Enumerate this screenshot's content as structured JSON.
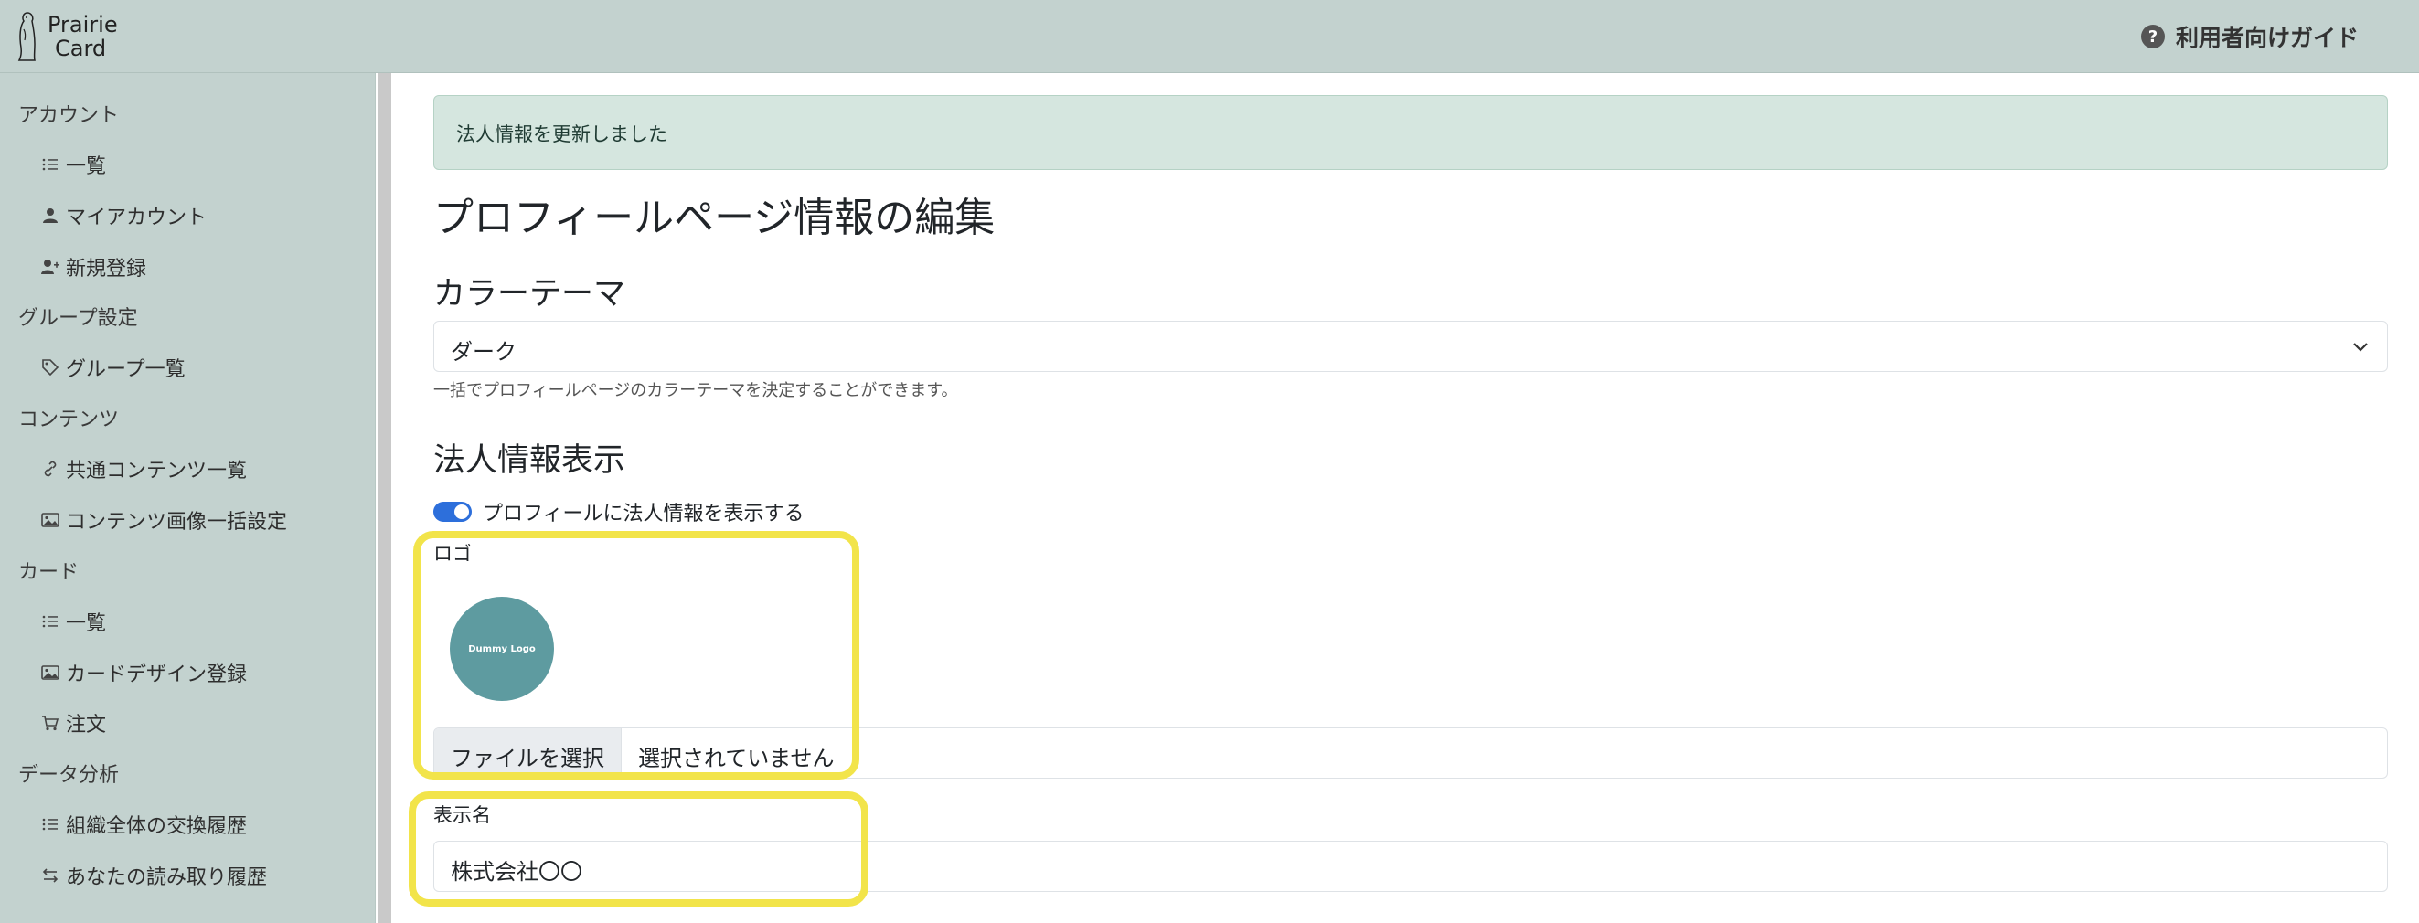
{
  "header": {
    "brand_line1": "Prairie",
    "brand_line2": "Card",
    "guide_label": "利用者向けガイド",
    "guide_icon": "?"
  },
  "sidebar": {
    "sections": [
      {
        "label": "アカウント",
        "items": [
          {
            "label": "一覧",
            "icon": "list-icon"
          },
          {
            "label": "マイアカウント",
            "icon": "person-icon"
          },
          {
            "label": "新規登録",
            "icon": "person-add-icon"
          }
        ]
      },
      {
        "label": "グループ設定",
        "items": [
          {
            "label": "グループ一覧",
            "icon": "tag-icon"
          }
        ]
      },
      {
        "label": "コンテンツ",
        "items": [
          {
            "label": "共通コンテンツ一覧",
            "icon": "link-icon"
          },
          {
            "label": "コンテンツ画像一括設定",
            "icon": "image-icon"
          }
        ]
      },
      {
        "label": "カード",
        "items": [
          {
            "label": "一覧",
            "icon": "list-icon"
          },
          {
            "label": "カードデザイン登録",
            "icon": "image-icon"
          },
          {
            "label": "注文",
            "icon": "cart-icon"
          }
        ]
      },
      {
        "label": "データ分析",
        "items": [
          {
            "label": "組織全体の交換履歴",
            "icon": "list-icon"
          },
          {
            "label": "あなたの読み取り履歴",
            "icon": "arrows-swap-icon"
          }
        ]
      }
    ]
  },
  "main": {
    "alert_text": "法人情報を更新しました",
    "page_title": "プロフィールページ情報の編集",
    "color_theme": {
      "heading": "カラーテーマ",
      "selected": "ダーク",
      "help": "一括でプロフィールページのカラーテーマを決定することができます。"
    },
    "corporate": {
      "heading": "法人情報表示",
      "toggle_label": "プロフィールに法人情報を表示する",
      "toggle_on": true,
      "logo_label": "ロゴ",
      "logo_text": "Dummy Logo",
      "file_button": "ファイルを選択",
      "file_status": "選択されていません",
      "display_name_label": "表示名",
      "display_name_value": "株式会社〇〇"
    }
  },
  "colors": {
    "sidebar_bg": "#c3d2cf",
    "alert_bg": "#d5e6df",
    "toggle": "#2d6fdb",
    "logo": "#5e9ba0",
    "highlight": "#f2e44a"
  }
}
